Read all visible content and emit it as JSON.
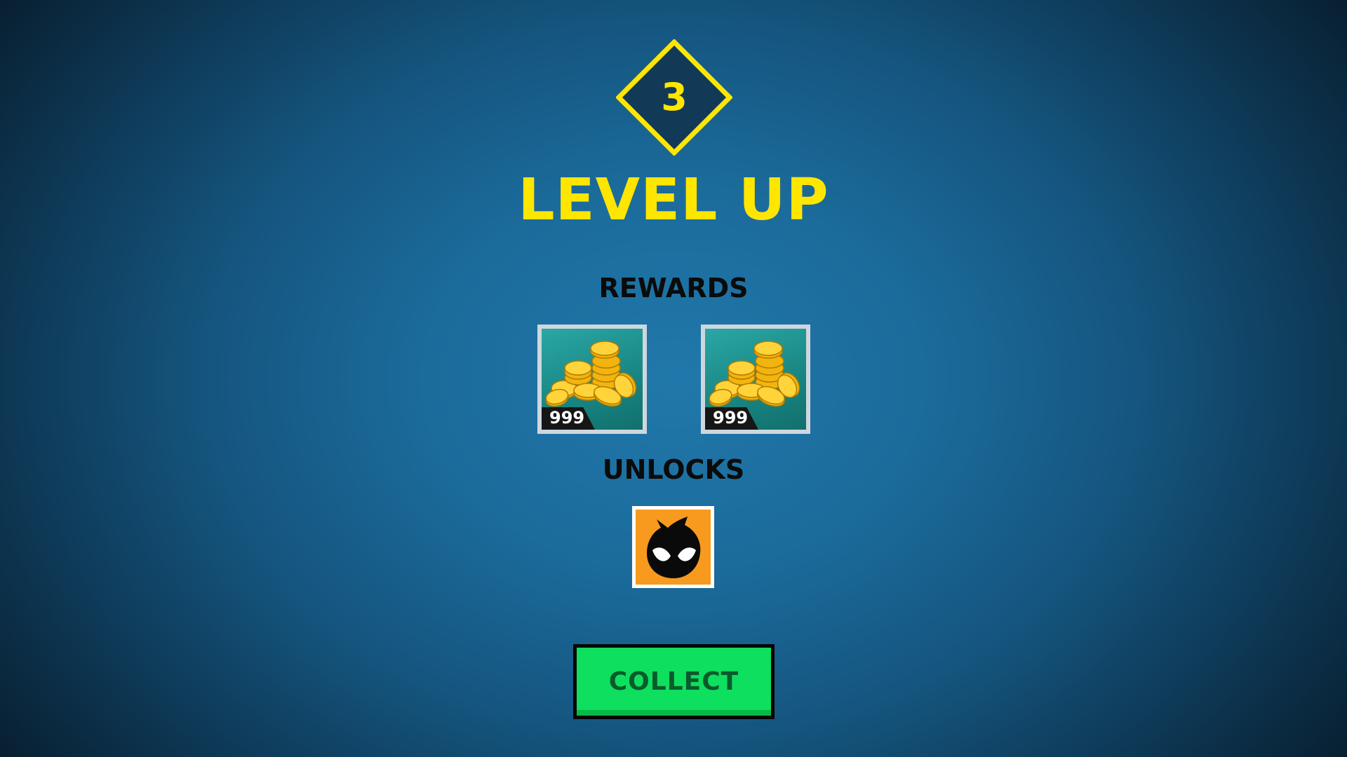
{
  "level": {
    "number": "3",
    "title": "LEVEL UP"
  },
  "rewards": {
    "heading": "REWARDS",
    "items": [
      {
        "icon": "gold-coins-icon",
        "amount": "999"
      },
      {
        "icon": "gold-coins-icon",
        "amount": "999"
      }
    ]
  },
  "unlocks": {
    "heading": "UNLOCKS",
    "items": [
      {
        "icon": "masked-hero-avatar-icon"
      }
    ]
  },
  "actions": {
    "collect_label": "COLLECT"
  },
  "colors": {
    "accent_yellow": "#ffe600",
    "background_blue": "#1b6b9b",
    "button_green": "#0edf5e",
    "reward_tile_teal": "#1a8c89",
    "unlock_tile_orange": "#f79a1e"
  }
}
